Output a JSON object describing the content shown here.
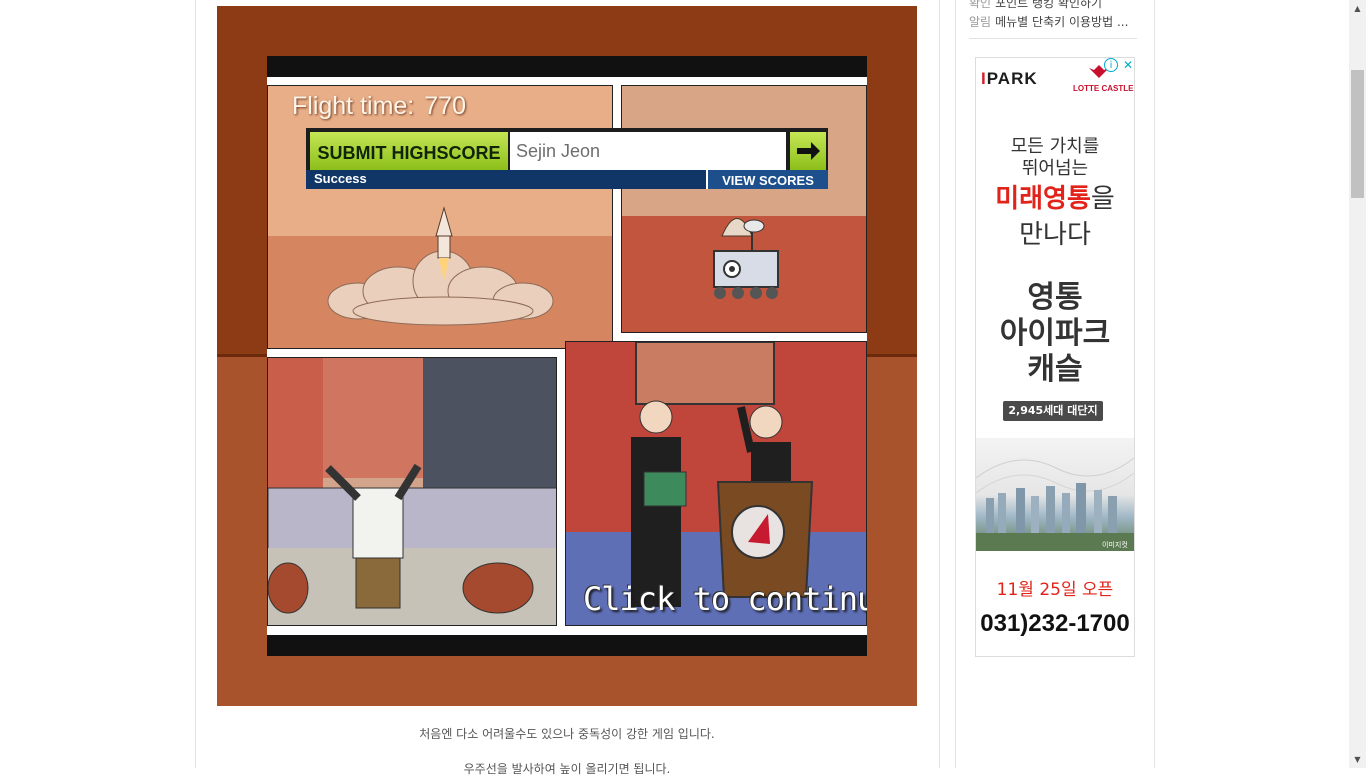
{
  "sidebar": {
    "links": [
      {
        "tag": "확인",
        "text": "포인트 랭킹 확인하기"
      },
      {
        "tag": "알림",
        "text": "메뉴별 단축키 이용방법 ..."
      }
    ]
  },
  "game": {
    "flight_time_label": "Flight time:",
    "flight_time_value": "770",
    "submit_label": "SUBMIT HIGHSCORE",
    "name_value": "Sejin Jeon",
    "status_text": "Success",
    "view_scores_label": "VIEW SCORES",
    "continue_text": "Click to continue..."
  },
  "article": {
    "caption1": "처음엔 다소 어려울수도 있으나 중독성이 강한 게임 입니다.",
    "caption2": "우주선을 발사하여 높이 올리기면 됩니다."
  },
  "ad": {
    "brand": "PARK",
    "brand_prefix": "I",
    "partner": "LOTTE CASTLE",
    "line1": "모든 가치를",
    "line2": "뛰어넘는",
    "highlight": "미래영통",
    "highlight_suffix": "을",
    "line3": "만나다",
    "title1": "영통",
    "title2": "아이파크",
    "title3": "캐슬",
    "badge": "2,945세대 대단지",
    "city_label": "이미지컷",
    "open_date": "11월 25일 오픈",
    "phone": "031)232-1700"
  },
  "colors": {
    "game_bg": "#8a3a16",
    "highscore_green": "#a6d130",
    "highscore_blue": "#0f3667",
    "ad_red": "#e2231a"
  }
}
